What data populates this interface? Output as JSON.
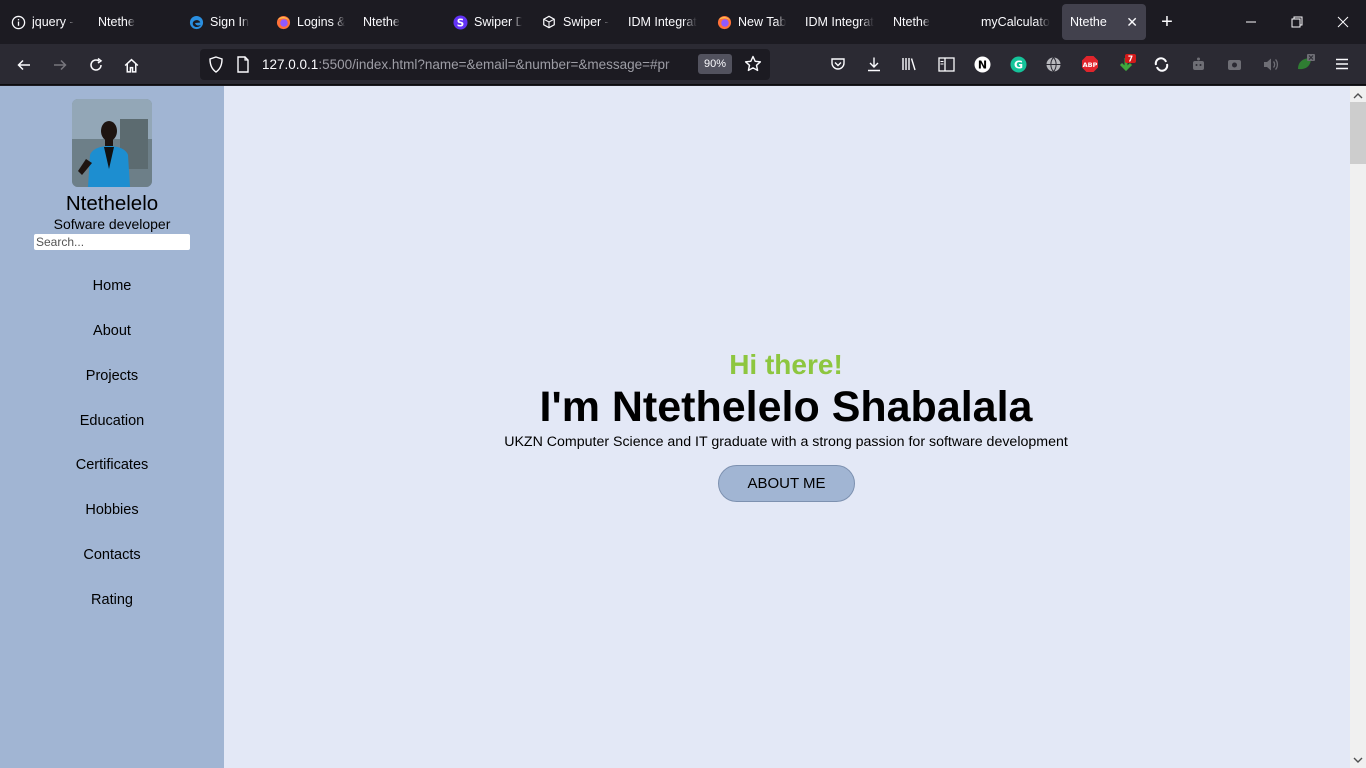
{
  "browser": {
    "tabs": [
      {
        "label": "jquery -",
        "icon": "info-icon"
      },
      {
        "label": "Ntethe",
        "icon": ""
      },
      {
        "label": "Sign In",
        "icon": "edge-icon"
      },
      {
        "label": "Logins &",
        "icon": "firefox-icon"
      },
      {
        "label": "Ntethe",
        "icon": ""
      },
      {
        "label": "Swiper D",
        "icon": "swiper-icon"
      },
      {
        "label": "Swiper -",
        "icon": "codesandbox-icon"
      },
      {
        "label": "IDM Integrat",
        "icon": ""
      },
      {
        "label": "New Tab",
        "icon": "firefox-icon"
      },
      {
        "label": "IDM Integrat",
        "icon": ""
      },
      {
        "label": "Ntethe",
        "icon": ""
      },
      {
        "label": "myCalculato",
        "icon": ""
      },
      {
        "label": "Ntethe",
        "icon": "",
        "active": true
      }
    ],
    "url_host": "127.0.0.1",
    "url_rest": ":5500/index.html?name=&email=&number=&message=#pr",
    "zoom": "90%",
    "extension_badge": "7",
    "accent": "#42414d"
  },
  "sidebar": {
    "name": "Ntethelelo",
    "role": "Sofware developer",
    "search_placeholder": "Search...",
    "nav": [
      "Home",
      "About",
      "Projects",
      "Education",
      "Certificates",
      "Hobbies",
      "Contacts",
      "Rating"
    ]
  },
  "hero": {
    "greeting": "Hi there!",
    "headline": "I'm Ntethelelo Shabalala",
    "tagline": "UKZN Computer Science and IT graduate with a strong passion for software development",
    "button": "ABOUT ME",
    "greeting_color": "#8dc63f"
  },
  "colors": {
    "sidebar_bg": "#a1b5d3",
    "page_bg": "#e3e8f6"
  }
}
